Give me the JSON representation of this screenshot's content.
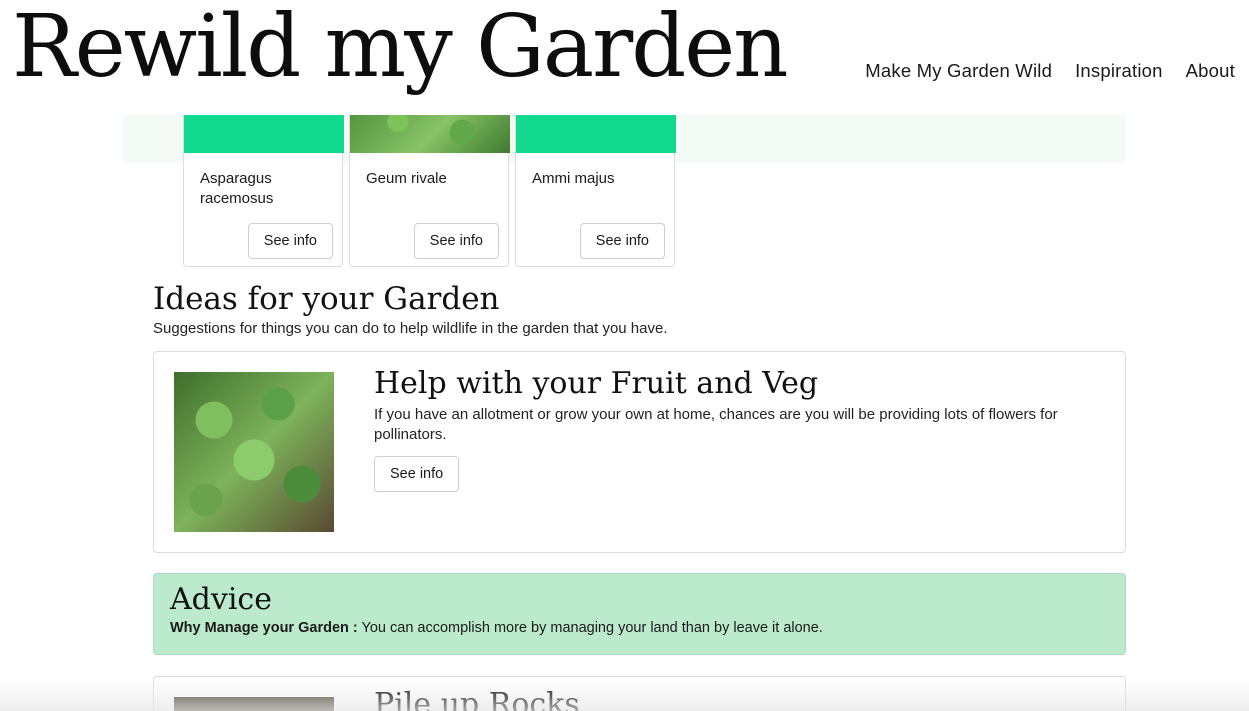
{
  "header": {
    "logo_text": "Rewild my Garden",
    "nav": [
      "Make My Garden Wild",
      "Inspiration",
      "About"
    ]
  },
  "plants": [
    {
      "name": "Asparagus racemosus",
      "button": "See info"
    },
    {
      "name": "Geum rivale",
      "button": "See info"
    },
    {
      "name": "Ammi majus",
      "button": "See info"
    }
  ],
  "ideas": {
    "title": "Ideas for your Garden",
    "subtitle": "Suggestions for things you can do to help wildlife in the garden that you have.",
    "cards": [
      {
        "title": "Help with your Fruit and Veg",
        "text": "If you have an allotment or grow your own at home, chances are you will be providing lots of flowers for pollinators.",
        "button": "See info"
      },
      {
        "title": "Pile up Rocks"
      }
    ]
  },
  "advice": {
    "title": "Advice",
    "label": "Why Manage your Garden :",
    "text": " You can accomplish more by managing your land than by leave it alone."
  },
  "colors": {
    "accent_green": "#11d98e",
    "advice_bg": "#bbebcc"
  }
}
